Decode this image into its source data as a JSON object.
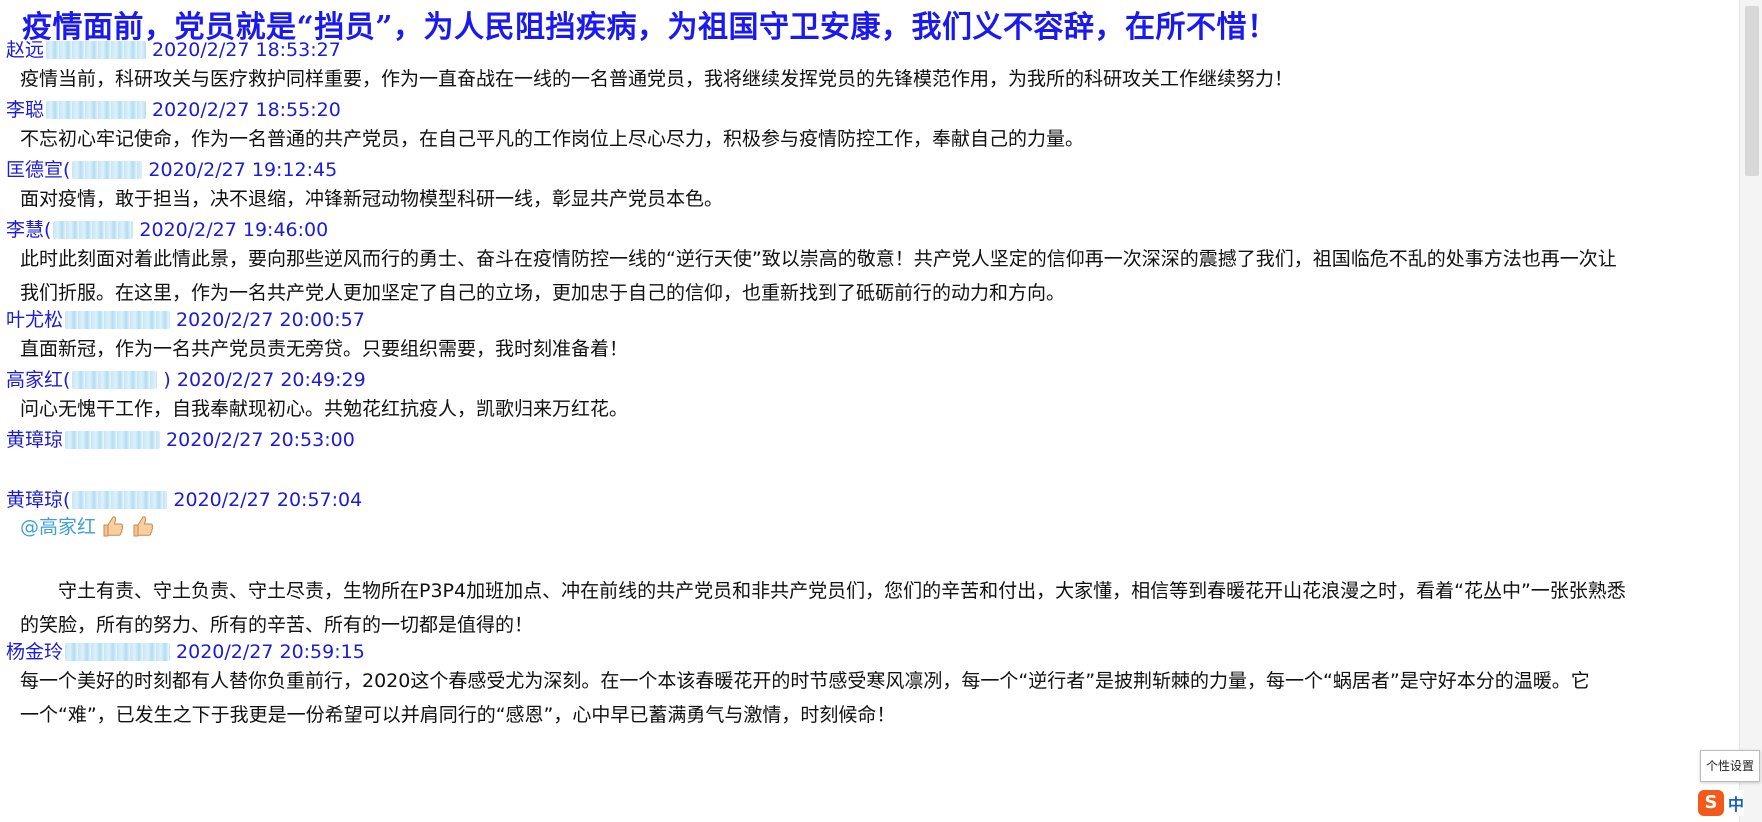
{
  "headline": "疫情面前，党员就是“挡员”，为人民阻挡疾病，为祖国守卫安康，我们义不容辞，在所不惜！",
  "messages": [
    {
      "author": "赵远",
      "timestamp": "2020/2/27 18:53:27",
      "body": [
        "疫情当前，科研攻关与医疗救护同样重要，作为一直奋战在一线的一名普通党员，我将继续发挥党员的先锋模范作用，为我所的科研攻关工作继续努力！"
      ]
    },
    {
      "author": "李聪",
      "timestamp": "2020/2/27 18:55:20",
      "body": [
        "不忘初心牢记使命，作为一名普通的共产党员，在自己平凡的工作岗位上尽心尽力，积极参与疫情防控工作，奉献自己的力量。"
      ]
    },
    {
      "author": "匡德宣(",
      "timestamp": "2020/2/27 19:12:45",
      "body": [
        "面对疫情，敢于担当，决不退缩，冲锋新冠动物模型科研一线，彰显共产党员本色。"
      ]
    },
    {
      "author": "李慧(",
      "timestamp": "2020/2/27 19:46:00",
      "body": [
        "此时此刻面对着此情此景，要向那些逆风而行的勇士、奋斗在疫情防控一线的“逆行天使”致以崇高的敬意！共产党人坚定的信仰再一次深深的震撼了我们，祖国临危不乱的处事方法也再一次让",
        "我们折服。在这里，作为一名共产党人更加坚定了自己的立场，更加忠于自己的信仰，也重新找到了砥砺前行的动力和方向。"
      ]
    },
    {
      "author": "叶尤松",
      "timestamp": "2020/2/27 20:00:57",
      "body": [
        "直面新冠，作为一名共产党员责无旁贷。只要组织需要，我时刻准备着！"
      ]
    },
    {
      "author": "高家红(",
      "timestamp": ") 2020/2/27 20:49:29",
      "body": [
        "问心无愧干工作，自我奉献现初心。共勉花红抗疫人，凯歌归来万红花。"
      ]
    },
    {
      "author": "黄璋琼",
      "timestamp": "2020/2/27 20:53:00",
      "body": []
    },
    {
      "author": "黄璋琼(",
      "timestamp": "2020/2/27 20:57:04",
      "body": [
        "守土有责、守土负责、守土尽责，生物所在P3P4加班加点、冲在前线的共产党员和非共产党员们，您们的辛苦和付出，大家懂，相信等到春暖花开山花浪漫之时，看着“花丛中”一张张熟悉",
        "的笑脸，所有的努力、所有的辛苦、所有的一切都是值得的！"
      ]
    },
    {
      "author": "杨金玲",
      "timestamp": "2020/2/27 20:59:15",
      "body": [
        "每一个美好的时刻都有人替你负重前行，2020这个春感受尤为深刻。在一个本该春暖花开的时节感受寒风凛冽，每一个“逆行者”是披荆斩棘的力量，每一个“蜗居者”是守好本分的温暖。它",
        "一个“难”，已发生之下于我更是一份希望可以并肩同行的“感恩”，心中早已蓄满勇气与激情，时刻候命！"
      ]
    }
  ],
  "mention": "@高家红",
  "reaction_icon": "thumbs-up-icon",
  "tooltip": "个性设置",
  "ime": {
    "logo": "S",
    "mode": "中"
  },
  "colors": {
    "headline": "#1a1af0",
    "header": "#1c1cd8",
    "mention": "#3da0d8",
    "body": "#111111"
  }
}
